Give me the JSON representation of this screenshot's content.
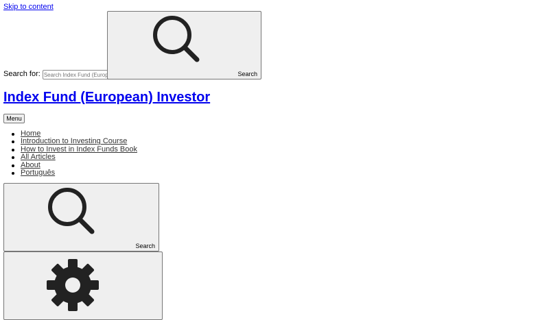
{
  "skip_link": "Skip to content",
  "header_search": {
    "label": "Search for:",
    "placeholder": "Search Index Fund (European) Investor",
    "button_label": "Search"
  },
  "site": {
    "title": "Index Fund (European) Investor"
  },
  "menu_button": "Menu",
  "nav": {
    "items": [
      {
        "label": "Home"
      },
      {
        "label": "Introduction to Investing Course"
      },
      {
        "label": "How to Invest in Index Funds Book"
      },
      {
        "label": "All Articles"
      },
      {
        "label": "About"
      },
      {
        "label": "Português"
      }
    ]
  },
  "toggle_search": {
    "button_label": "Search",
    "icon": "search-icon"
  },
  "settings_toggle": {
    "icon": "gear-icon"
  }
}
